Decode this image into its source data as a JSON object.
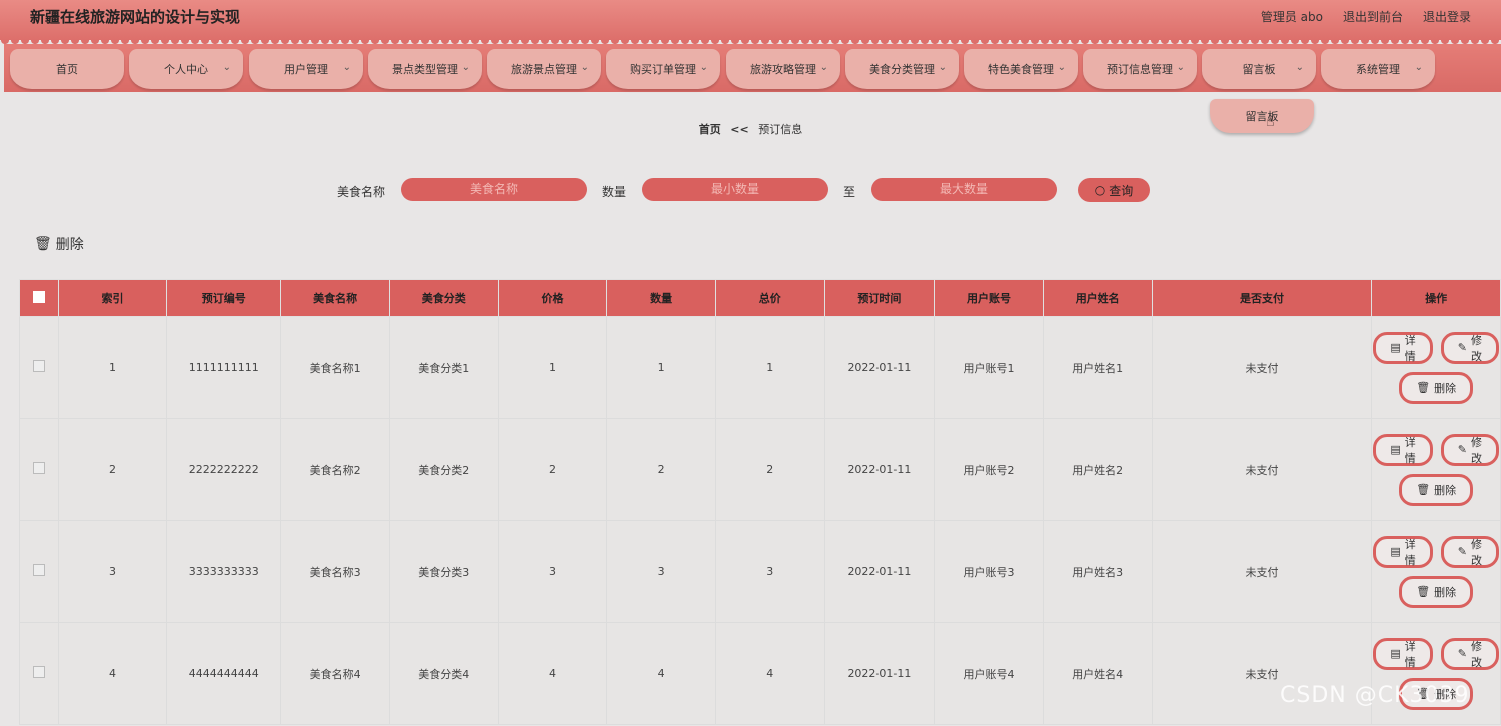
{
  "header": {
    "title": "新疆在线旅游网站的设计与实现",
    "user": "管理员 abo",
    "front_link": "退出到前台",
    "logout": "退出登录"
  },
  "nav": [
    {
      "label": "首页",
      "chevron": false
    },
    {
      "label": "个人中心",
      "chevron": true
    },
    {
      "label": "用户管理",
      "chevron": true
    },
    {
      "label": "景点类型管理",
      "chevron": true
    },
    {
      "label": "旅游景点管理",
      "chevron": true
    },
    {
      "label": "购买订单管理",
      "chevron": true
    },
    {
      "label": "旅游攻略管理",
      "chevron": true
    },
    {
      "label": "美食分类管理",
      "chevron": true
    },
    {
      "label": "特色美食管理",
      "chevron": true
    },
    {
      "label": "预订信息管理",
      "chevron": true
    },
    {
      "label": "留言板",
      "chevron": true
    },
    {
      "label": "系统管理",
      "chevron": true
    }
  ],
  "dropdown": {
    "item": "留言板"
  },
  "breadcrumb": {
    "home": "首页",
    "sep": "<<",
    "current": "预订信息"
  },
  "search": {
    "name_label": "美食名称",
    "name_placeholder": "美食名称",
    "qty_label": "数量",
    "min_placeholder": "最小数量",
    "to_label": "至",
    "max_placeholder": "最大数量",
    "button": "查询"
  },
  "bulk_delete": "删除",
  "table": {
    "headers": [
      "索引",
      "预订编号",
      "美食名称",
      "美食分类",
      "价格",
      "数量",
      "总价",
      "预订时间",
      "用户账号",
      "用户姓名",
      "是否支付",
      "操作"
    ],
    "rows": [
      [
        "1",
        "1111111111",
        "美食名称1",
        "美食分类1",
        "1",
        "1",
        "1",
        "2022-01-11",
        "用户账号1",
        "用户姓名1",
        "未支付"
      ],
      [
        "2",
        "2222222222",
        "美食名称2",
        "美食分类2",
        "2",
        "2",
        "2",
        "2022-01-11",
        "用户账号2",
        "用户姓名2",
        "未支付"
      ],
      [
        "3",
        "3333333333",
        "美食名称3",
        "美食分类3",
        "3",
        "3",
        "3",
        "2022-01-11",
        "用户账号3",
        "用户姓名3",
        "未支付"
      ],
      [
        "4",
        "4444444444",
        "美食名称4",
        "美食分类4",
        "4",
        "4",
        "4",
        "2022-01-11",
        "用户账号4",
        "用户姓名4",
        "未支付"
      ]
    ],
    "ops": {
      "detail": "详情",
      "edit": "修改",
      "delete": "删除"
    }
  },
  "watermark": "CSDN @CK3039",
  "colors": {
    "primary": "#d9605e",
    "nav_tab": "#eab0a9",
    "background": "#e8e6e6"
  }
}
